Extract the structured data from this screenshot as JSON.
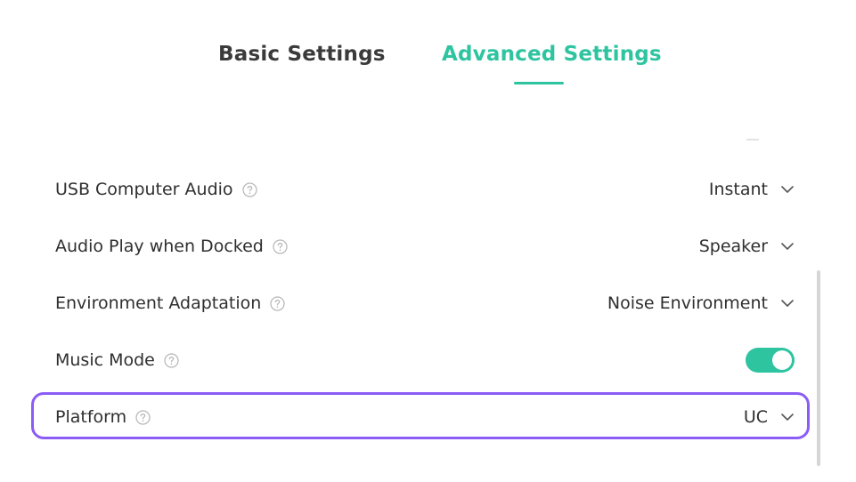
{
  "tabs": {
    "basic_label": "Basic Settings",
    "advanced_label": "Advanced Settings",
    "active": "Advanced Settings"
  },
  "settings": [
    {
      "label": "USB Computer Audio",
      "value": "Instant",
      "control": "dropdown"
    },
    {
      "label": "Audio Play when Docked",
      "value": "Speaker",
      "control": "dropdown"
    },
    {
      "label": "Environment Adaptation",
      "value": "Noise Environment",
      "control": "dropdown"
    },
    {
      "label": "Music Mode",
      "value": "on",
      "control": "toggle"
    },
    {
      "label": "Platform",
      "value": "UC",
      "control": "dropdown"
    }
  ],
  "colors": {
    "accent": "#2ec4a0",
    "highlight": "#8b5cf6",
    "text": "#2f2f2f"
  },
  "icons": {
    "help": "question-circle-icon",
    "dropdown": "chevron-down-icon"
  }
}
